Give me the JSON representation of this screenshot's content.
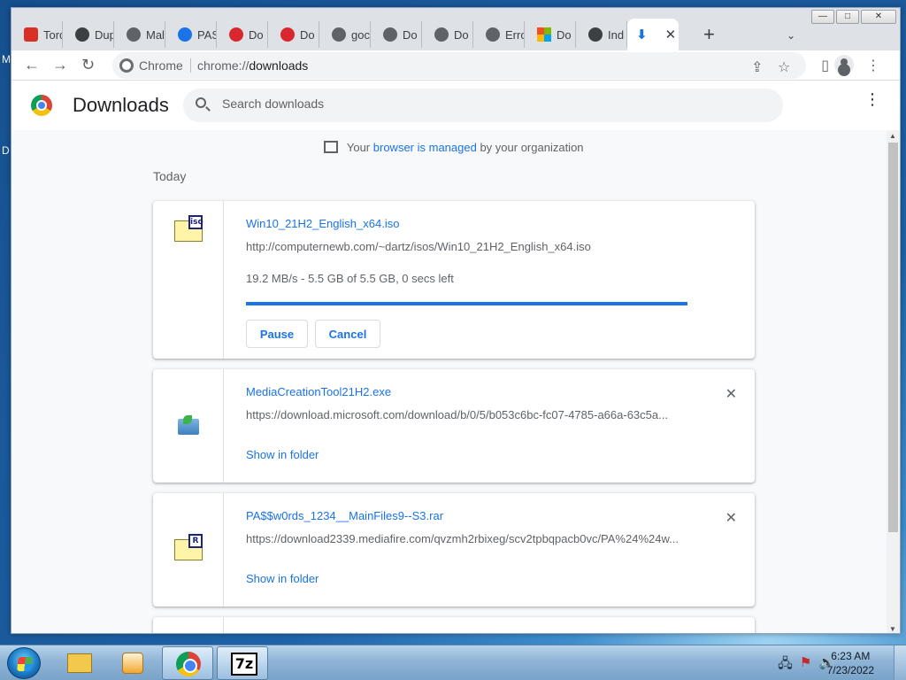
{
  "desktop": {
    "glyphs": [
      "M",
      "D"
    ]
  },
  "tabs": [
    {
      "label": "Torc",
      "icon": "torrent-icon",
      "color": "#d93025"
    },
    {
      "label": "Dup",
      "icon": "dup-icon",
      "color": "#3c4043"
    },
    {
      "label": "Mal",
      "icon": "globe-icon",
      "color": "#5f6368"
    },
    {
      "label": "PAS",
      "icon": "pas-icon",
      "color": "#1a73e8"
    },
    {
      "label": "Do",
      "icon": "mega-icon",
      "color": "#d9272e"
    },
    {
      "label": "Do",
      "icon": "mega-icon",
      "color": "#d9272e"
    },
    {
      "label": "goc",
      "icon": "goc-icon",
      "color": "#5f6368"
    },
    {
      "label": "Do",
      "icon": "goc-icon",
      "color": "#5f6368"
    },
    {
      "label": "Do",
      "icon": "goc-icon",
      "color": "#5f6368"
    },
    {
      "label": "Erro",
      "icon": "globe-icon",
      "color": "#5f6368"
    },
    {
      "label": "Do",
      "icon": "microsoft-icon",
      "color": "#f25022"
    },
    {
      "label": "Ind",
      "icon": "index-icon",
      "color": "#3c4043"
    }
  ],
  "active_tab": {
    "icon": "download-icon",
    "glyph": "⬇",
    "close": "✕"
  },
  "new_tab": "+",
  "tab_search": "⌄",
  "window_controls": {
    "minimize": "—",
    "maximize": "□",
    "close": "✕"
  },
  "toolbar": {
    "back": "←",
    "forward": "→",
    "reload": "↻",
    "scheme": "Chrome",
    "url_host": "chrome://",
    "url_path": "downloads",
    "share": "⇪",
    "star": "☆",
    "sidepanel": "▯",
    "menu": "⋮"
  },
  "page": {
    "title": "Downloads",
    "search_placeholder": "Search downloads",
    "menu": "⋮",
    "managed": {
      "prefix": "Your",
      "link": "browser is managed",
      "suffix": "by your organization"
    },
    "date_header": "Today"
  },
  "downloads": [
    {
      "name": "Win10_21H2_English_x64.iso",
      "url": "http://computernewb.com/~dartz/isos/Win10_21H2_English_x64.iso",
      "status": "19.2 MB/s - 5.5 GB of 5.5 GB, 0 secs left",
      "progress": 1.0,
      "icon_tag": "iso",
      "pause": "Pause",
      "cancel": "Cancel"
    },
    {
      "name": "MediaCreationTool21H2.exe",
      "url": "https://download.microsoft.com/download/b/0/5/b053c6bc-fc07-4785-a66a-63c5a...",
      "action": "Show in folder",
      "remove": "✕"
    },
    {
      "name": "PA$$w0rds_1234__MainFiles9--S3.rar",
      "url": "https://download2339.mediafire.com/qvzmh2rbixeg/scv2tpbqpacb0vc/PA%24%24w...",
      "icon_tag": "R",
      "action": "Show in folder",
      "remove": "✕"
    }
  ],
  "scrollbar": {
    "up": "▲",
    "down": "▼"
  },
  "taskbar": {
    "apps": [
      "explorer",
      "media-player",
      "chrome",
      "7-zip"
    ],
    "sevenzip_label": "7z",
    "tray": {
      "network": "🖧",
      "flag": "⚑",
      "volume": "🔊"
    },
    "time": "6:23 AM",
    "date": "7/23/2022"
  }
}
